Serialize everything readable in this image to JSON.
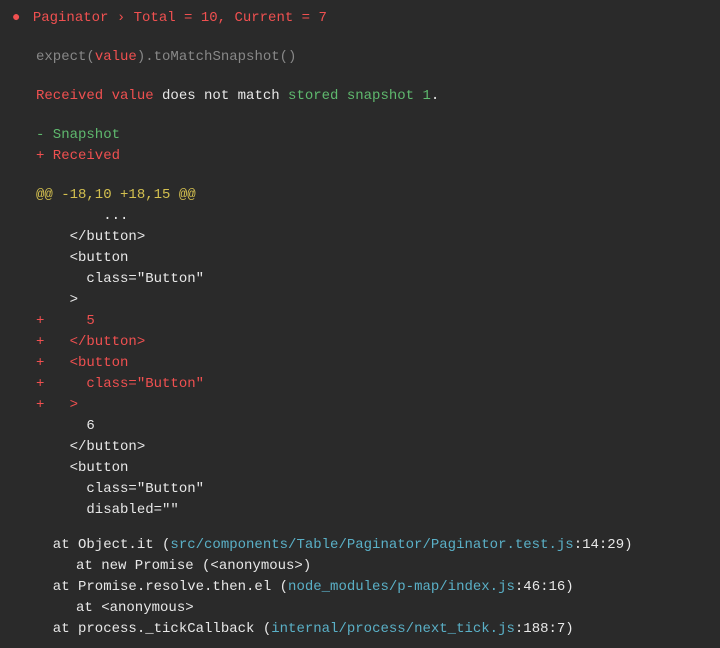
{
  "header": {
    "bullet": "●",
    "title": "Paginator › Total = 10, Current = 7"
  },
  "expect": {
    "prefix": "expect(",
    "value": "value",
    "suffix": ").toMatchSnapshot()"
  },
  "message": {
    "part1": "Received value",
    "part2": " does not match ",
    "part3": "stored snapshot 1",
    "part4": "."
  },
  "legend": {
    "snapshot": "- Snapshot",
    "received": "+ Received"
  },
  "diff": {
    "header": "@@ -18,10 +18,15 @@",
    "lines": [
      {
        "text": "        ...",
        "color": "white"
      },
      {
        "text": "    </button>",
        "color": "white"
      },
      {
        "text": "    <button",
        "color": "white"
      },
      {
        "text": "      class=\"Button\"",
        "color": "white"
      },
      {
        "text": "    >",
        "color": "white"
      },
      {
        "text": "+     5",
        "color": "red"
      },
      {
        "text": "+   </button>",
        "color": "red"
      },
      {
        "text": "+   <button",
        "color": "red"
      },
      {
        "text": "+     class=\"Button\"",
        "color": "red"
      },
      {
        "text": "+   >",
        "color": "red"
      },
      {
        "text": "      6",
        "color": "white"
      },
      {
        "text": "    </button>",
        "color": "white"
      },
      {
        "text": "    <button",
        "color": "white"
      },
      {
        "text": "      class=\"Button\"",
        "color": "white"
      },
      {
        "text": "      disabled=\"\"",
        "color": "white"
      }
    ]
  },
  "stack": [
    {
      "type": "main",
      "prefix": "at Object.it (",
      "path": "src/components/Table/Paginator/Paginator.test.js",
      "suffix": ":14:29)"
    },
    {
      "type": "sub",
      "text": "at new Promise (<anonymous>)"
    },
    {
      "type": "main",
      "prefix": "at Promise.resolve.then.el (",
      "path": "node_modules/p-map/index.js",
      "suffix": ":46:16)"
    },
    {
      "type": "sub",
      "text": "at <anonymous>"
    },
    {
      "type": "main",
      "prefix": "at process._tickCallback (",
      "path": "internal/process/next_tick.js",
      "suffix": ":188:7)"
    }
  ]
}
